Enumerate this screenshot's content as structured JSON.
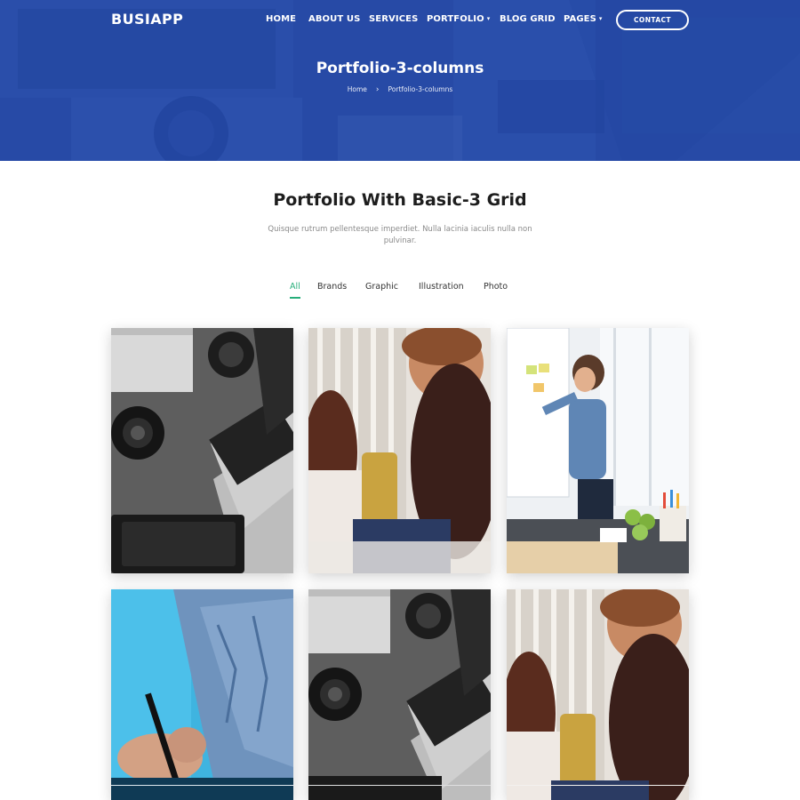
{
  "header": {
    "logo": "BUSIAPP",
    "nav": [
      {
        "label": "HOME",
        "dropdown": false
      },
      {
        "label": "ABOUT US",
        "dropdown": false
      },
      {
        "label": "SERVICES",
        "dropdown": false
      },
      {
        "label": "PORTFOLIO",
        "dropdown": true
      },
      {
        "label": "BLOG GRID",
        "dropdown": false
      },
      {
        "label": "PAGES",
        "dropdown": true
      }
    ],
    "contact_label": "CONTACT",
    "caret_glyph": "▾"
  },
  "hero": {
    "title": "Portfolio-3-columns",
    "breadcrumb": {
      "home": "Home",
      "separator": "›",
      "current": "Portfolio-3-columns"
    }
  },
  "portfolio": {
    "title": "Portfolio With Basic-3 Grid",
    "subtitle": "Quisque rutrum pellentesque imperdiet. Nulla lacinia iaculis nulla non pulvinar.",
    "filters": [
      {
        "label": "All",
        "active": true
      },
      {
        "label": "Brands",
        "active": false
      },
      {
        "label": "Graphic",
        "active": false
      },
      {
        "label": "Illustration",
        "active": false
      },
      {
        "label": "Photo",
        "active": false
      }
    ],
    "items": [
      {
        "image": "laptop-camera-desk-photo"
      },
      {
        "image": "meeting-people-photo"
      },
      {
        "image": "whiteboard-presentation-photo"
      },
      {
        "image": "hand-writing-pen-photo"
      },
      {
        "image": "laptop-camera-desk-photo"
      },
      {
        "image": "meeting-people-photo"
      }
    ]
  },
  "colors": {
    "hero_blue": "#2a4fa8",
    "accent_green": "#27ae7a",
    "title_dark": "#1d1d1d",
    "subtitle_gray": "#8a8a8a"
  }
}
